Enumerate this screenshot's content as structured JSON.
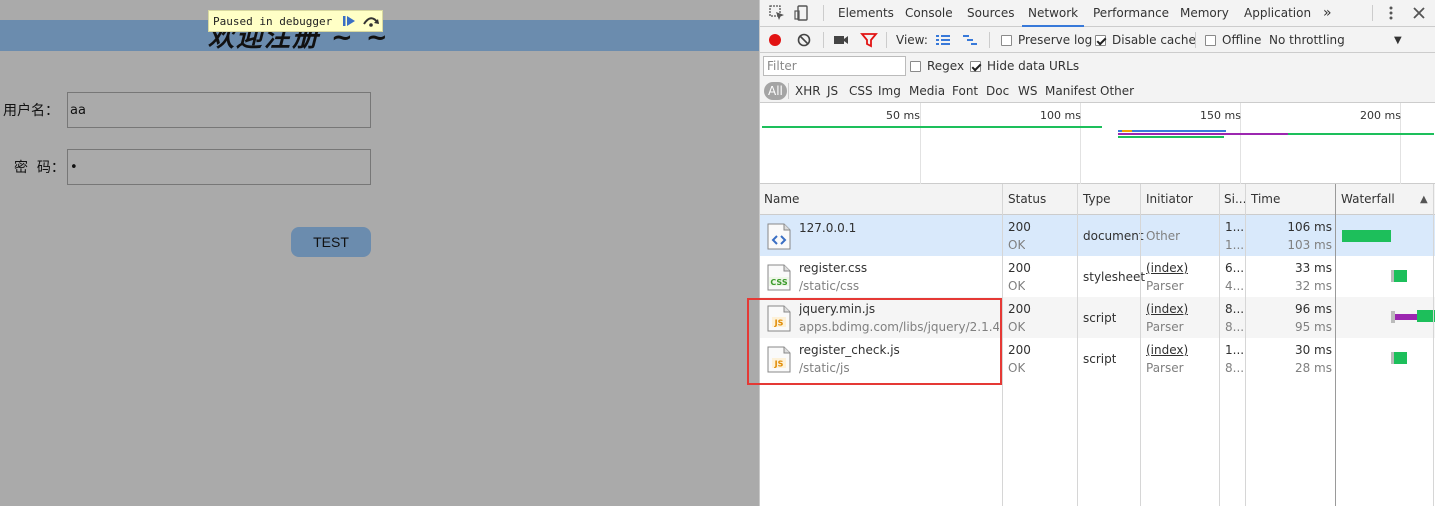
{
  "page": {
    "banner_title": "欢迎注册 ~ ~",
    "paused_text": "Paused in debugger",
    "form": {
      "username_label": "用户名：",
      "username_value": "aa",
      "password_label": "密  码：",
      "password_value": "•",
      "submit_label": "TEST"
    }
  },
  "devtools": {
    "tabs": [
      "Elements",
      "Console",
      "Sources",
      "Network",
      "Performance",
      "Memory",
      "Application"
    ],
    "active_tab": "Network",
    "more_tabs": "»",
    "toolbar": {
      "view_label": "View:",
      "preserve_log": "Preserve log",
      "disable_cache": "Disable cache",
      "offline": "Offline",
      "throttling": "No throttling"
    },
    "filter": {
      "placeholder": "Filter",
      "regex": "Regex",
      "hide_data_urls": "Hide data URLs"
    },
    "types": [
      "All",
      "XHR",
      "JS",
      "CSS",
      "Img",
      "Media",
      "Font",
      "Doc",
      "WS",
      "Manifest",
      "Other"
    ],
    "timeline_ticks": [
      "50 ms",
      "100 ms",
      "150 ms",
      "200 ms"
    ],
    "columns": [
      "Name",
      "Status",
      "Type",
      "Initiator",
      "Si...",
      "Time",
      "Waterfall"
    ],
    "rows": [
      {
        "icon": "html-file-icon",
        "name": "127.0.0.1",
        "path": "",
        "status": "200",
        "status_text": "OK",
        "type": "document",
        "initiator": "Other",
        "initiator_sub": "",
        "size": "1...",
        "size_sub": "1...",
        "time": "106 ms",
        "latency": "103 ms"
      },
      {
        "icon": "css-file-icon",
        "name": "register.css",
        "path": "/static/css",
        "status": "200",
        "status_text": "OK",
        "type": "stylesheet",
        "initiator": "(index)",
        "initiator_sub": "Parser",
        "size": "6...",
        "size_sub": "4...",
        "time": "33 ms",
        "latency": "32 ms"
      },
      {
        "icon": "js-file-icon",
        "name": "jquery.min.js",
        "path": "apps.bdimg.com/libs/jquery/2.1.4",
        "status": "200",
        "status_text": "OK",
        "type": "script",
        "initiator": "(index)",
        "initiator_sub": "Parser",
        "size": "8...",
        "size_sub": "8...",
        "time": "96 ms",
        "latency": "95 ms"
      },
      {
        "icon": "js-file-icon",
        "name": "register_check.js",
        "path": "/static/js",
        "status": "200",
        "status_text": "OK",
        "type": "script",
        "initiator": "(index)",
        "initiator_sub": "Parser",
        "size": "1...",
        "size_sub": "8...",
        "time": "30 ms",
        "latency": "28 ms"
      }
    ],
    "colors": {
      "accent": "#3879d9",
      "waterfall_green": "#1dbf5b",
      "waterfall_purple": "#9c27b0",
      "highlight": "#e53935"
    }
  }
}
